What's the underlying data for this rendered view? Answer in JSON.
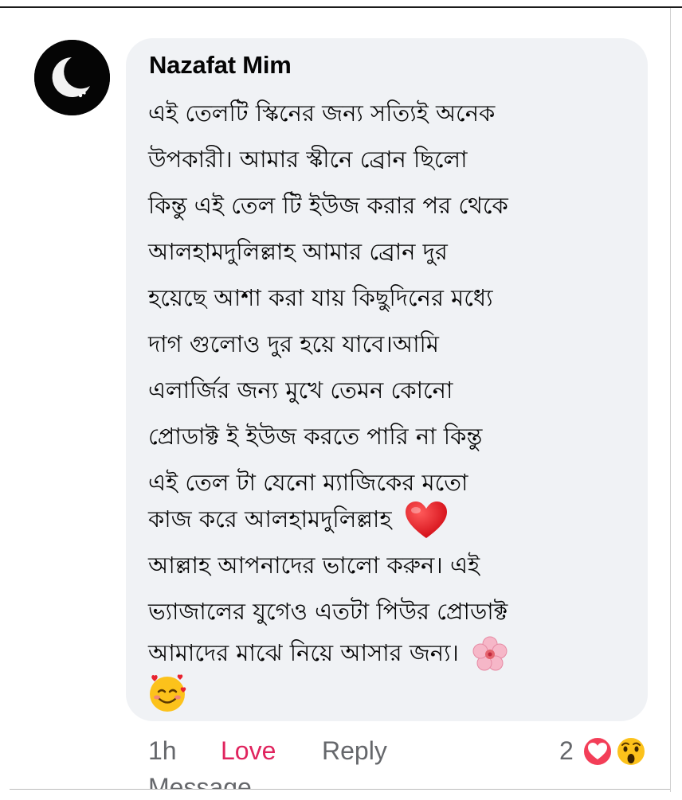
{
  "comment": {
    "author": "Nazafat Mim",
    "avatar_icon": "crescent-moon-icon",
    "lines": [
      "এই তেলটি স্কিনের জন্য সত্যিই অনেক",
      "উপকারী। আমার স্কীনে ব্রোন ছিলো",
      "কিন্তু এই তেল টি ইউজ করার পর থেকে",
      "আলহামদুলিল্লাহ আমার ব্রোন দুর",
      "হয়েছে আশা করা যায় কিছুদিনের মধ্যে",
      "দাগ গুলোও দুর হয়ে যাবে।আমি",
      "এলার্জির জন্য মুখে তেমন কোনো",
      "প্রোডাক্ট ই ইউজ করতে পারি না কিন্তু",
      "এই তেল টা যেনো ম্যাজিকের মতো",
      "কাজ করে আলহামদুলিল্লাহ",
      "আল্লাহ আপনাদের ভালো করুন। এই",
      "ভ্যাজালের যুগেও এতটা পিউর প্রোডাক্ট",
      "আমাদের মাঝে নিয়ে আসার জন্য।"
    ],
    "emojis": [
      "red-heart-icon",
      "cherry-blossom-icon",
      "smiling-face-with-hearts-icon"
    ]
  },
  "footer": {
    "time": "1h",
    "love": "Love",
    "reply": "Reply",
    "reaction_count": "2",
    "reaction_icons": [
      "love-reaction-icon",
      "wow-reaction-icon"
    ],
    "cut_off_text": "Message"
  },
  "colors": {
    "bubble": "#f0f2f5",
    "love": "#e0245e",
    "muted": "#65676b",
    "text": "#050505"
  }
}
